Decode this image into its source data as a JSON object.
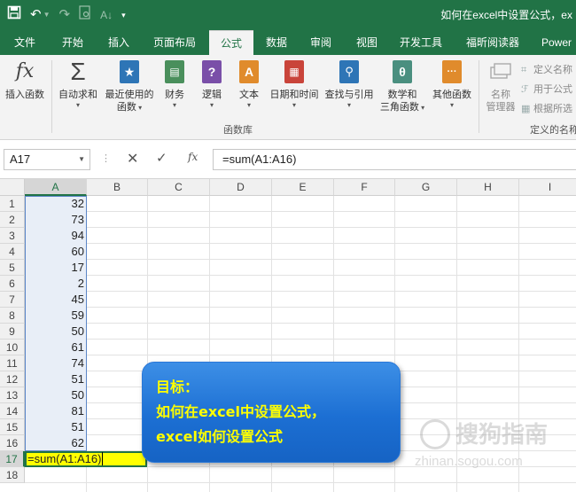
{
  "window": {
    "title": "如何在excel中设置公式，ex"
  },
  "tabs": [
    {
      "label": "文件"
    },
    {
      "label": "开始"
    },
    {
      "label": "插入"
    },
    {
      "label": "页面布局"
    },
    {
      "label": "公式",
      "active": true
    },
    {
      "label": "数据"
    },
    {
      "label": "审阅"
    },
    {
      "label": "视图"
    },
    {
      "label": "开发工具"
    },
    {
      "label": "福昕阅读器"
    },
    {
      "label": "Power"
    }
  ],
  "ribbon": {
    "insert_function": {
      "icon_text": "fx",
      "label": "插入函数"
    },
    "autosum": {
      "icon_text": "Σ",
      "label": "自动求和"
    },
    "recent": {
      "label1": "最近使用的",
      "label2": "函数"
    },
    "finance": {
      "label": "财务"
    },
    "logic": {
      "icon_text": "?",
      "label": "逻辑"
    },
    "text": {
      "icon_text": "A",
      "label": "文本"
    },
    "datetime": {
      "label": "日期和时间"
    },
    "lookup": {
      "label": "查找与引用"
    },
    "math": {
      "icon_text": "θ",
      "label1": "数学和",
      "label2": "三角函数"
    },
    "other": {
      "icon_text": "···",
      "label": "其他函数"
    },
    "name_manager": {
      "label1": "名称",
      "label2": "管理器"
    },
    "define_name": "定义名称",
    "use_in_formula": "用于公式",
    "create_from_selection": "根据所选",
    "group_function_library": "函数库",
    "group_defined_names": "定义的名称"
  },
  "formula_bar": {
    "name_box": "A17",
    "formula": "=sum(A1:A16)",
    "fx_label": "fx"
  },
  "columns": [
    "A",
    "B",
    "C",
    "D",
    "E",
    "F",
    "G",
    "H",
    "I"
  ],
  "rows": [
    "1",
    "2",
    "3",
    "4",
    "5",
    "6",
    "7",
    "8",
    "9",
    "10",
    "11",
    "12",
    "13",
    "14",
    "15",
    "16",
    "17",
    "18"
  ],
  "column_a_values": [
    "32",
    "73",
    "94",
    "60",
    "17",
    "2",
    "45",
    "59",
    "50",
    "61",
    "74",
    "51",
    "50",
    "81",
    "51",
    "62"
  ],
  "editing_cell": {
    "ref": "A17",
    "text": "=sum(A1:A16)"
  },
  "callout": {
    "line1": "目标：",
    "line2": "如何在excel中设置公式，",
    "line3": "excel如何设置公式"
  },
  "watermark": {
    "text": "搜狗指南",
    "url": "zhinan.sogou.com"
  },
  "colors": {
    "excel_green": "#217346",
    "callout_blue": "#1c6fd3",
    "callout_text": "#ffff00",
    "edit_cell_fill": "#ffff00"
  }
}
